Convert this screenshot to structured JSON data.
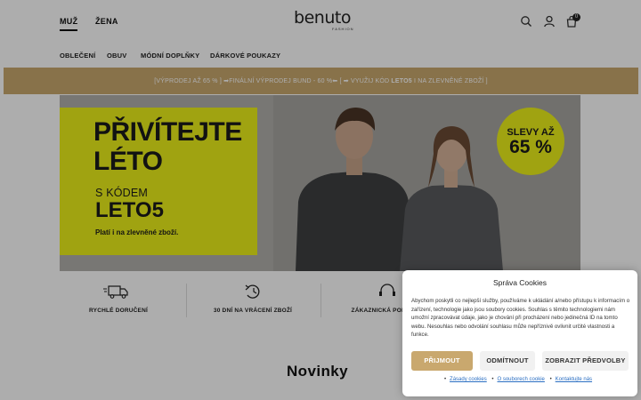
{
  "header": {
    "genders": [
      "MUŽ",
      "ŽENA"
    ],
    "logo": {
      "main": "benuto",
      "sub": "FASHION"
    },
    "icons": [
      "search-icon",
      "user-icon",
      "cart-icon"
    ],
    "cart_count": "0"
  },
  "nav": {
    "items": [
      "OBLEČENÍ",
      "OBUV",
      "MÓDNÍ DOPLŇKY",
      "DÁRKOVÉ POUKAZY"
    ]
  },
  "promo": {
    "part1": "[VÝPRODEJ AŽ 65 % ] ➡FINÁLNÍ VÝPRODEJ BUND - 60 %⬅ [ ➡ VYUŽIJ KÓD ",
    "code": "LETO5",
    "part2": " I NA ZLEVNĚNÉ ZBOŽÍ ]",
    "color": "#c9a86e"
  },
  "hero": {
    "headline_line1": "PŘIVÍTEJTE",
    "headline_line2": "LÉTO",
    "subline": "S KÓDEM",
    "code": "LETO5",
    "note": "Platí i na zlevněné zboží.",
    "badge_line1": "SLEVY AŽ",
    "badge_line2": "65 %",
    "accent": "#ecf11a"
  },
  "features": [
    {
      "icon": "truck-icon",
      "label": "RYCHLÉ DORUČENÍ"
    },
    {
      "icon": "history-icon",
      "label": "30 DNÍ NA VRÁCENÍ ZBOŽÍ"
    },
    {
      "icon": "support-icon",
      "label": "ZÁKAZNICKÁ PODPORA"
    }
  ],
  "section_title": "Novinky",
  "cookie": {
    "title": "Správa Cookies",
    "text": "Abychom poskytli co nejlepší služby, používáme k ukládání a/nebo přístupu k informacím o zařízení, technologie jako jsou soubory cookies. Souhlas s těmito technologiemi nám umožní zpracovávat údaje, jako je chování při procházení nebo jedinečná ID na tomto webu. Nesouhlas nebo odvolání souhlasu může nepříznivě ovlivnit určité vlastnosti a funkce.",
    "accept": "PŘIJMOUT",
    "deny": "ODMÍTNOUT",
    "preferences": "ZOBRAZIT PŘEDVOLBY",
    "links": [
      "Zásady cookies",
      "O souborech cookie",
      "Kontaktujte nás"
    ]
  }
}
